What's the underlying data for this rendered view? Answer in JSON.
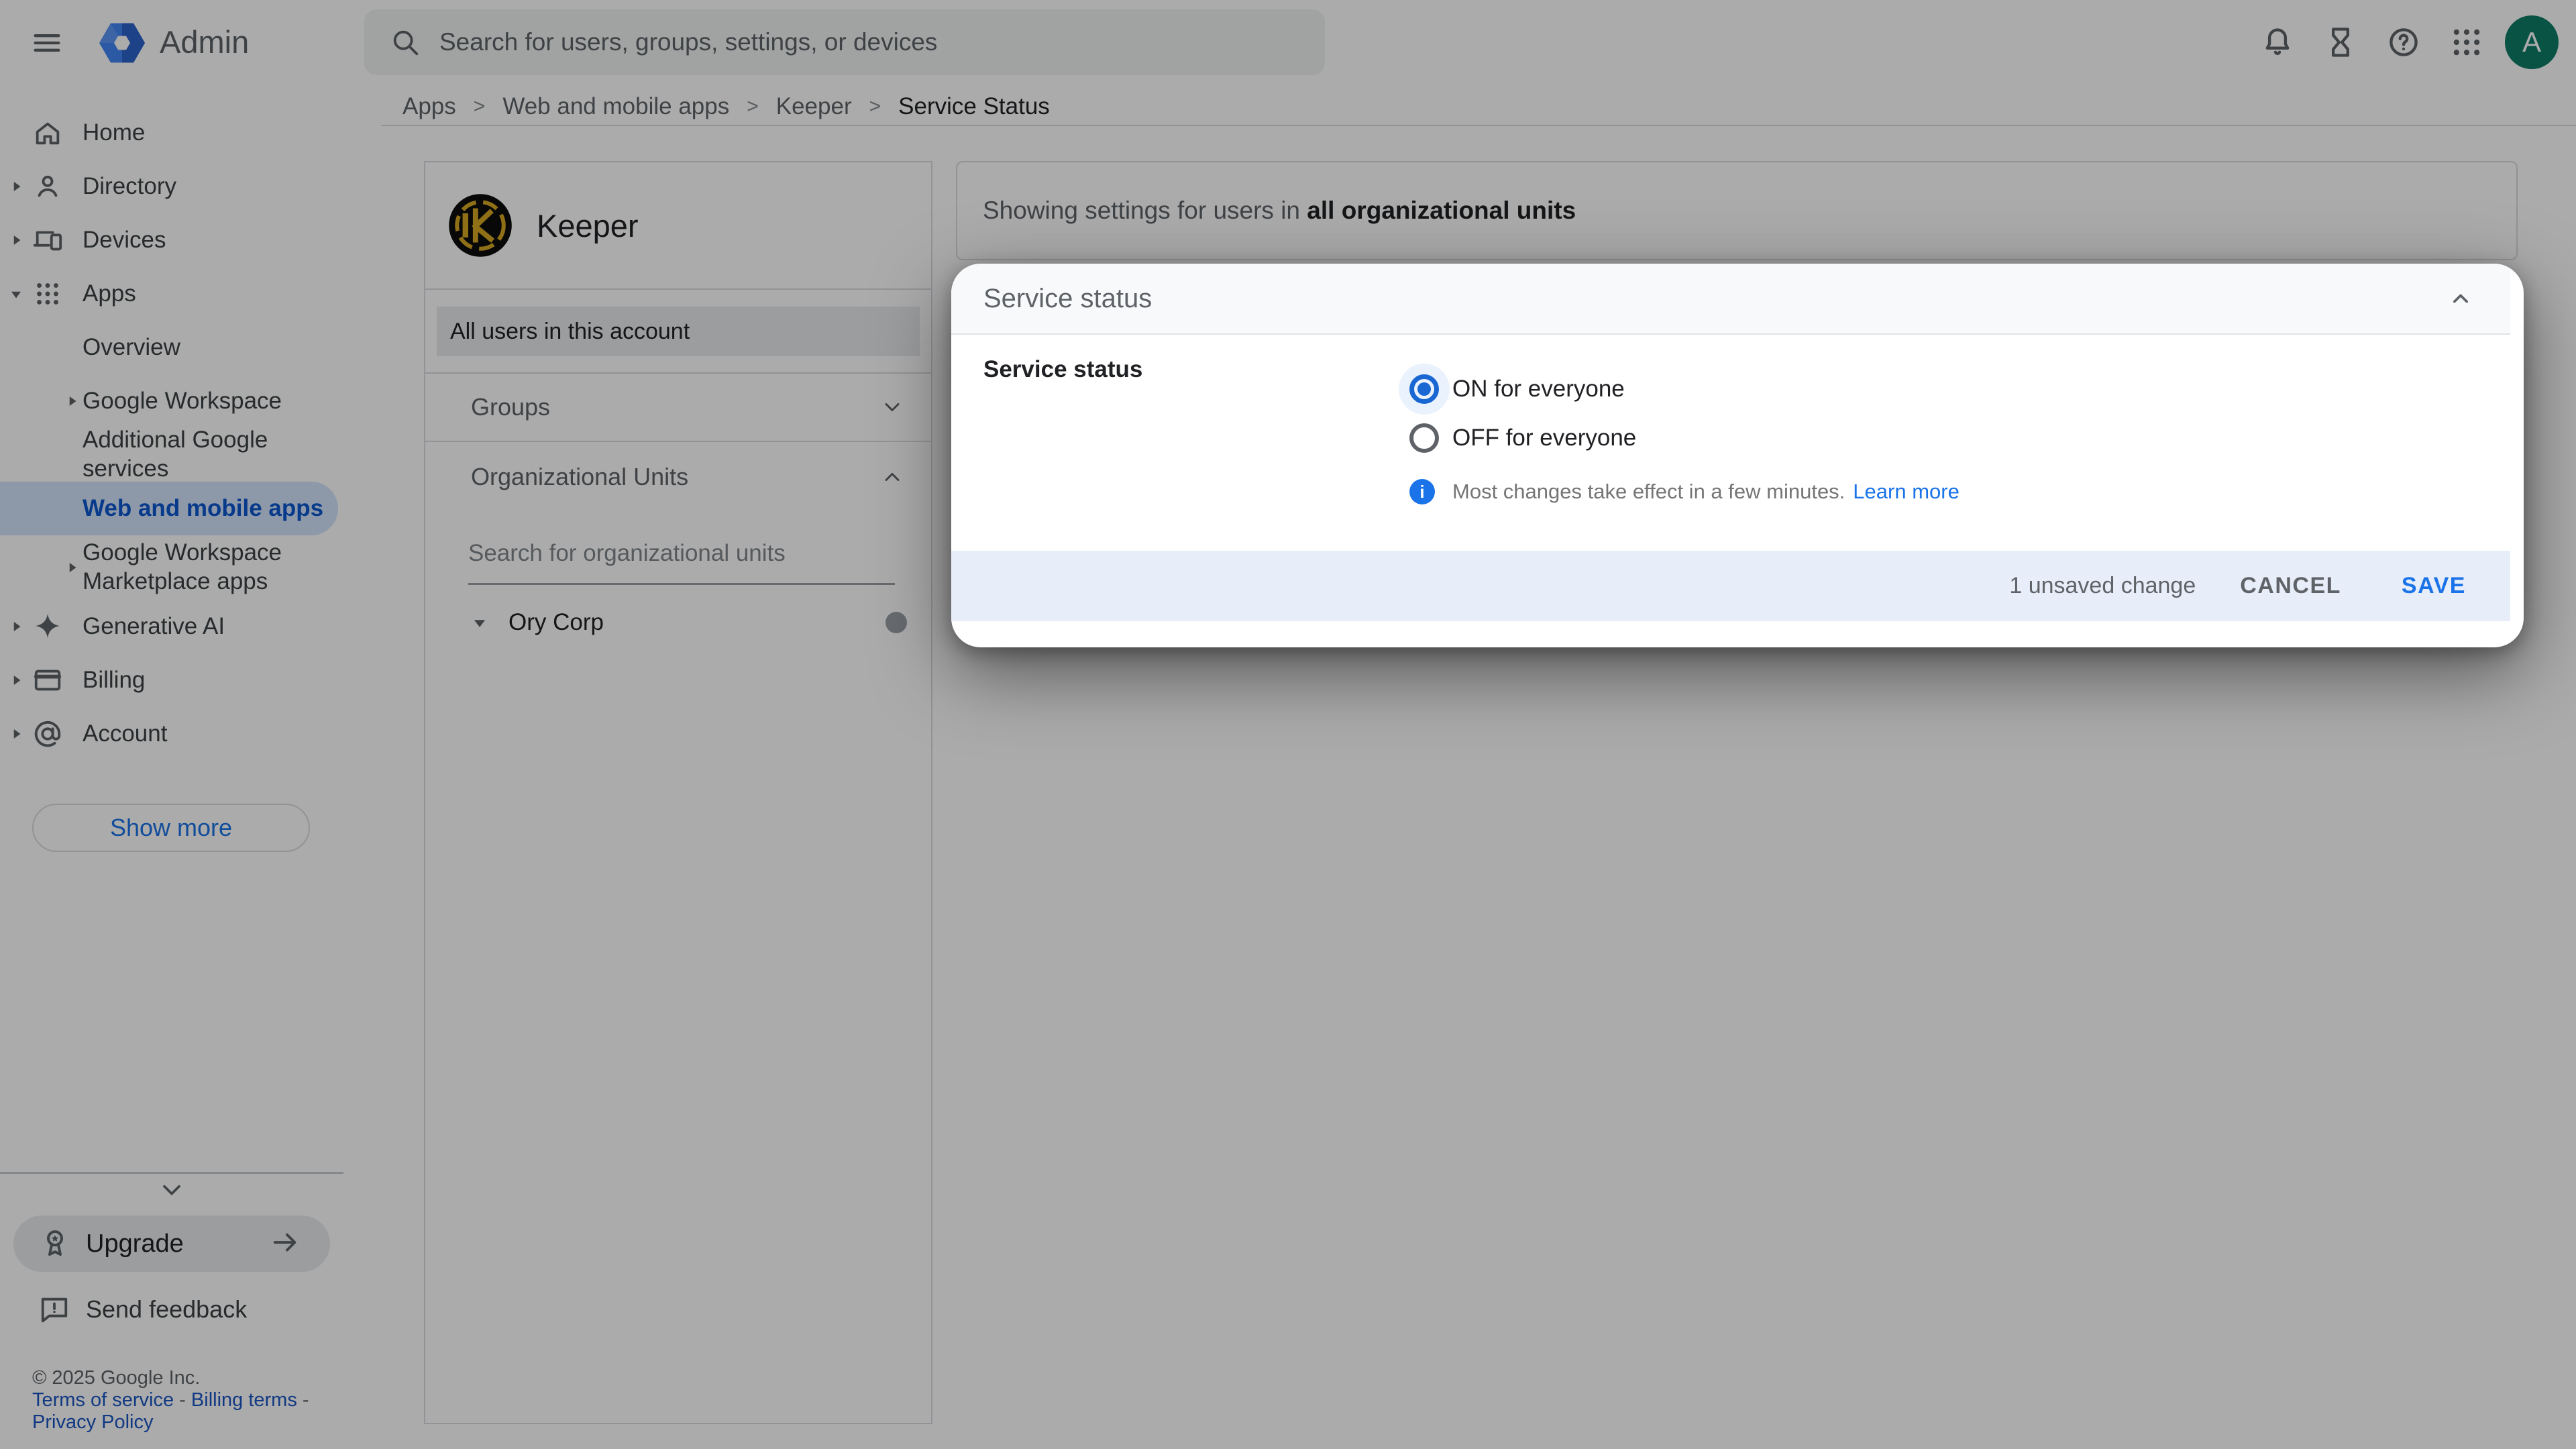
{
  "topbar": {
    "app_title": "Admin",
    "search_placeholder": "Search for users, groups, settings, or devices",
    "avatar_letter": "A"
  },
  "breadcrumb": {
    "separator": ">",
    "items": [
      {
        "label": "Apps"
      },
      {
        "label": "Web and mobile apps"
      },
      {
        "label": "Keeper"
      },
      {
        "label": "Service Status"
      }
    ]
  },
  "sidebar": {
    "items": [
      {
        "label": "Home"
      },
      {
        "label": "Directory"
      },
      {
        "label": "Devices"
      },
      {
        "label": "Apps"
      },
      {
        "label": "Overview"
      },
      {
        "label": "Google Workspace"
      },
      {
        "label": "Additional Google services"
      },
      {
        "label": "Web and mobile apps"
      },
      {
        "label": "Google Workspace Marketplace apps"
      },
      {
        "label": "Generative AI"
      },
      {
        "label": "Billing"
      },
      {
        "label": "Account"
      }
    ],
    "show_more_label": "Show more",
    "upgrade_label": "Upgrade",
    "send_feedback_label": "Send feedback",
    "footer_copyright": "© 2025 Google Inc.",
    "footer_sep": "-",
    "footer_links": [
      {
        "label": "Terms of service"
      },
      {
        "label": "Billing terms"
      },
      {
        "label": "Privacy Policy"
      }
    ]
  },
  "app_panel": {
    "app_name": "Keeper",
    "all_users_label": "All users in this account",
    "groups_label": "Groups",
    "org_units_label": "Organizational Units",
    "org_search_placeholder": "Search for organizational units",
    "org_unit_root": "Ory Corp"
  },
  "settings_banner": {
    "prefix": "Showing settings for users in ",
    "scope": "all organizational units"
  },
  "dialog": {
    "title": "Service status",
    "field_label": "Service status",
    "option_on": "ON for everyone",
    "option_off": "OFF for everyone",
    "selected_option": "ON for everyone",
    "info_text": "Most changes take effect in a few minutes.",
    "info_link_label": "Learn more",
    "unsaved_text": "1 unsaved change",
    "cancel_label": "CANCEL",
    "save_label": "SAVE"
  },
  "colors": {
    "accent_blue": "#1a73e8",
    "radio_selected": "#1967d2",
    "selected_nav_bg": "#d3e3fd",
    "selected_nav_text": "#0b57d0",
    "dialog_footer_bg": "#e8eef9",
    "avatar_bg": "#0e7c66",
    "keeper_gold": "#d7a722"
  }
}
